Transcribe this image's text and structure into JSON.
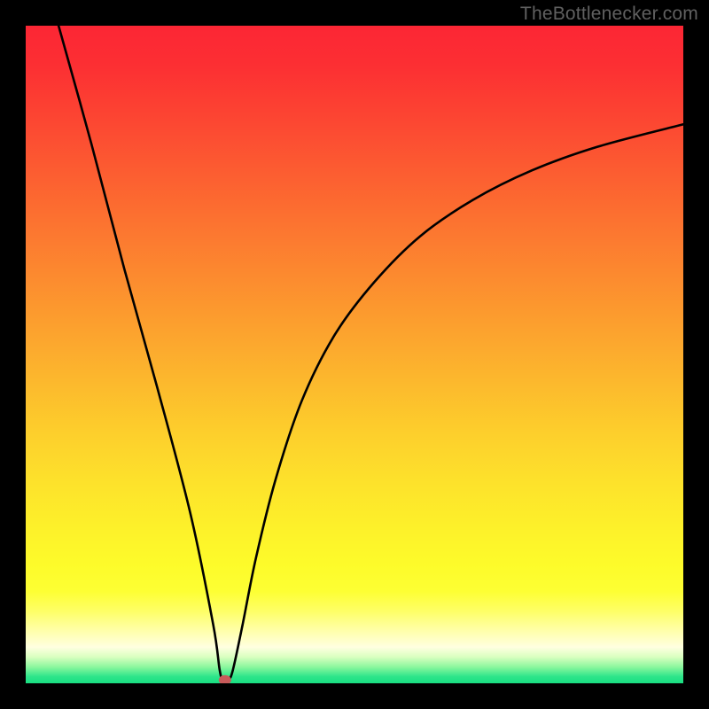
{
  "source_label": "TheBottlenecker.com",
  "chart_data": {
    "type": "line",
    "title": "",
    "xlabel": "",
    "ylabel": "",
    "xlim": [
      0,
      100
    ],
    "ylim": [
      0,
      100
    ],
    "series": [
      {
        "name": "bottleneck-curve",
        "x": [
          5,
          10,
          15,
          20,
          25,
          28.5,
          29.5,
          30,
          30.8,
          31.5,
          33,
          35,
          38,
          42,
          47,
          53,
          60,
          68,
          77,
          87,
          100
        ],
        "y": [
          100,
          82,
          63,
          45,
          26,
          9,
          2,
          0.5,
          0.5,
          2,
          9,
          19,
          31,
          43,
          53,
          61,
          68,
          73.5,
          78,
          81.6,
          85
        ]
      }
    ],
    "marker": {
      "cx": 30.3,
      "cy": 0.5,
      "fill": "#c85a5a"
    },
    "gradient_stops": [
      {
        "offset": 0,
        "color": "#fc2634"
      },
      {
        "offset": 0.06,
        "color": "#fc2f33"
      },
      {
        "offset": 0.14,
        "color": "#fc4532"
      },
      {
        "offset": 0.22,
        "color": "#fc5c31"
      },
      {
        "offset": 0.3,
        "color": "#fc7330"
      },
      {
        "offset": 0.38,
        "color": "#fc8a2f"
      },
      {
        "offset": 0.46,
        "color": "#fca12e"
      },
      {
        "offset": 0.54,
        "color": "#fcb82d"
      },
      {
        "offset": 0.62,
        "color": "#fdcf2c"
      },
      {
        "offset": 0.7,
        "color": "#fde32b"
      },
      {
        "offset": 0.77,
        "color": "#fdf22a"
      },
      {
        "offset": 0.82,
        "color": "#fdfb2a"
      },
      {
        "offset": 0.86,
        "color": "#fdff33"
      },
      {
        "offset": 0.89,
        "color": "#feff66"
      },
      {
        "offset": 0.92,
        "color": "#ffffaa"
      },
      {
        "offset": 0.945,
        "color": "#ffffe0"
      },
      {
        "offset": 0.96,
        "color": "#d9ffc0"
      },
      {
        "offset": 0.975,
        "color": "#8cf79e"
      },
      {
        "offset": 0.99,
        "color": "#2de58a"
      },
      {
        "offset": 1.0,
        "color": "#19df82"
      }
    ]
  }
}
